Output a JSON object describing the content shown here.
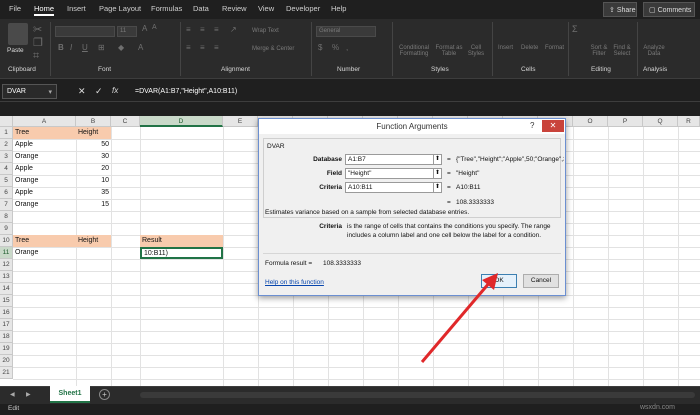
{
  "menu": {
    "items": [
      "File",
      "Home",
      "Insert",
      "Page Layout",
      "Formulas",
      "Data",
      "Review",
      "View",
      "Developer",
      "Help"
    ],
    "share": "Share",
    "comments": "Comments"
  },
  "ribbon": {
    "paste": "Paste",
    "groups": [
      "Clipboard",
      "Font",
      "Alignment",
      "Number",
      "Styles",
      "Cells",
      "Editing",
      "Analysis"
    ],
    "font_size": "11",
    "wrap_text": "Wrap Text",
    "merge_center": "Merge & Center",
    "number_format": "General",
    "styles": [
      "Conditional Formatting",
      "Format as Table",
      "Cell Styles"
    ],
    "cells": [
      "Insert",
      "Delete",
      "Format"
    ],
    "editing": [
      "Sort & Filter",
      "Find & Select"
    ],
    "analysis": "Analyze Data"
  },
  "formula_bar": {
    "name_box": "DVAR",
    "formula": "=DVAR(A1:B7,\"Height\",A10:B11)"
  },
  "sheet": {
    "columns": [
      "A",
      "B",
      "C",
      "D",
      "E",
      "F",
      "G",
      "H",
      "I",
      "J",
      "K",
      "L",
      "M",
      "N",
      "O",
      "P",
      "Q",
      "R"
    ],
    "rows": [
      "1",
      "2",
      "3",
      "4",
      "5",
      "6",
      "7",
      "8",
      "9",
      "10",
      "11",
      "12",
      "13",
      "14",
      "15",
      "16",
      "17",
      "18",
      "19",
      "20",
      "21"
    ],
    "a1": "Tree",
    "b1": "Height",
    "data": [
      {
        "tree": "Apple",
        "height": "50"
      },
      {
        "tree": "Orange",
        "height": "30"
      },
      {
        "tree": "Apple",
        "height": "20"
      },
      {
        "tree": "Orange",
        "height": "10"
      },
      {
        "tree": "Apple",
        "height": "35"
      },
      {
        "tree": "Orange",
        "height": "15"
      }
    ],
    "a10": "Tree",
    "b10": "Height",
    "d10": "Result",
    "a11": "Orange",
    "d11": "10:B11)"
  },
  "dialog": {
    "title": "Function Arguments",
    "help": "?",
    "close": "✕",
    "function_name": "DVAR",
    "args": [
      {
        "label": "Database",
        "value": "A1:B7",
        "result": "{\"Tree\",\"Height\";\"Apple\",50;\"Orange\",3"
      },
      {
        "label": "Field",
        "value": "\"Height\"",
        "result": "\"Height\""
      },
      {
        "label": "Criteria",
        "value": "A10:B11",
        "result": "A10:B11"
      }
    ],
    "eq": "=",
    "calc_result": "108.3333333",
    "description": "Estimates variance based on a sample from selected database entries.",
    "arg_help_label": "Criteria",
    "arg_help_line1": "is the range of cells that contains the conditions you specify. The range",
    "arg_help_line2": "includes a column label and one cell below the label for a condition.",
    "formula_result_label": "Formula result =",
    "formula_result_value": "108.3333333",
    "help_link": "Help on this function",
    "ok": "OK",
    "cancel": "Cancel"
  },
  "tabs": {
    "sheet1": "Sheet1",
    "add": "+",
    "prev": "◀",
    "next": "▶"
  },
  "status": {
    "mode": "Edit"
  },
  "watermark": "wsxdn.com",
  "colors": {
    "accent": "#217346",
    "header_fill": "#f8cbad",
    "arrow": "#e0282a"
  }
}
